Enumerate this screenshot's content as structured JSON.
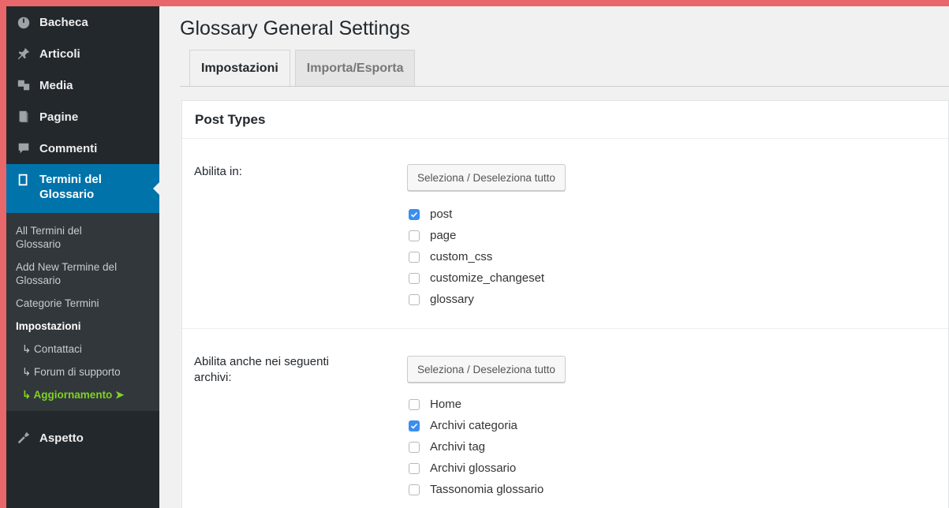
{
  "sidebar": {
    "menu_top": [
      {
        "label": "Bacheca",
        "icon": "dashboard-icon"
      },
      {
        "label": "Articoli",
        "icon": "pin-icon"
      },
      {
        "label": "Media",
        "icon": "media-icon"
      },
      {
        "label": "Pagine",
        "icon": "pages-icon"
      },
      {
        "label": "Commenti",
        "icon": "comments-icon"
      }
    ],
    "active": {
      "label": "Termini del\nGlossario",
      "icon": "book-icon"
    },
    "submenu": [
      {
        "label": "All Termini del\nGlossario"
      },
      {
        "label": "Add New Termine del\nGlossario"
      },
      {
        "label": "Categorie Termini"
      },
      {
        "label": "Impostazioni"
      },
      {
        "label": "↳ Contattaci"
      },
      {
        "label": "↳ Forum di supporto"
      },
      {
        "label": "↳ Aggiornamento ➤"
      }
    ],
    "menu_bottom": {
      "label": "Aspetto",
      "icon": "appearance-icon"
    }
  },
  "page": {
    "title": "Glossary General Settings",
    "tabs": [
      "Impostazioni",
      "Importa/Esporta"
    ],
    "section_title": "Post Types",
    "rows": [
      {
        "label": "Abilita in:",
        "button": "Seleziona / Deseleziona tutto",
        "options": [
          {
            "label": "post",
            "checked": true
          },
          {
            "label": "page",
            "checked": false
          },
          {
            "label": "custom_css",
            "checked": false
          },
          {
            "label": "customize_changeset",
            "checked": false
          },
          {
            "label": "glossary",
            "checked": false
          }
        ]
      },
      {
        "label": "Abilita anche nei seguenti\narchivi:",
        "button": "Seleziona / Deseleziona tutto",
        "options": [
          {
            "label": "Home",
            "checked": false
          },
          {
            "label": "Archivi categoria",
            "checked": true
          },
          {
            "label": "Archivi tag",
            "checked": false
          },
          {
            "label": "Archivi glossario",
            "checked": false
          },
          {
            "label": "Tassonomia glossario",
            "checked": false
          }
        ]
      }
    ]
  },
  "colors": {
    "frame": "#e8676b",
    "sidebar": "#23282d",
    "active": "#0073aa",
    "highlight": "#7ed321",
    "checkbox": "#3b8ef0"
  }
}
